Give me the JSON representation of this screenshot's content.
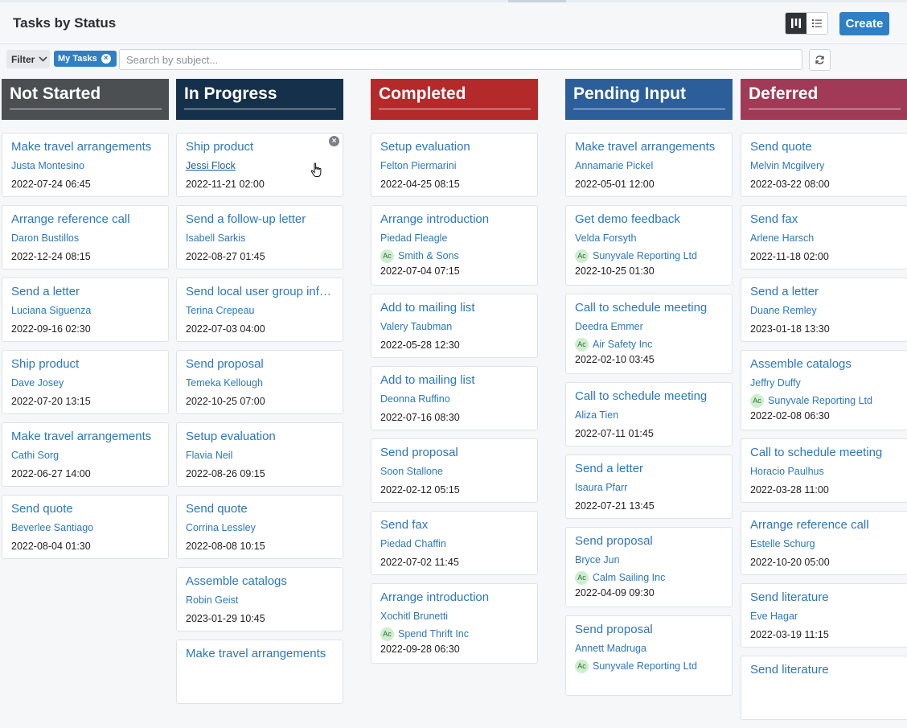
{
  "header": {
    "title": "Tasks by Status",
    "create_label": "Create"
  },
  "view_toggle": {
    "icons": [
      "board-view-icon",
      "list-view-icon"
    ],
    "active": "board"
  },
  "filter_bar": {
    "filter_label": "Filter",
    "active_chip": "My Tasks",
    "search": {
      "placeholder": "Search by subject...",
      "value": ""
    }
  },
  "columns": [
    {
      "title": "Not Started",
      "color": "#4c4f52",
      "cards": [
        {
          "title": "Make travel arrangements",
          "contact": "Justa Montesino",
          "date": "2022-07-24 06:45"
        },
        {
          "title": "Arrange reference call",
          "contact": "Daron Bustillos",
          "date": "2022-12-24 08:15"
        },
        {
          "title": "Send a letter",
          "contact": "Luciana Siguenza",
          "date": "2022-09-16 02:30"
        },
        {
          "title": "Ship product",
          "contact": "Dave Josey",
          "date": "2022-07-20 13:15"
        },
        {
          "title": "Make travel arrangements",
          "contact": "Cathi Sorg",
          "date": "2022-06-27 14:00"
        },
        {
          "title": "Send quote",
          "contact": "Beverlee Santiago",
          "date": "2022-08-04 01:30"
        }
      ]
    },
    {
      "title": "In Progress",
      "color": "#15304a",
      "cards": [
        {
          "title": "Ship product",
          "contact": "Jessi Flock",
          "date": "2022-11-21 02:00",
          "hover": true
        },
        {
          "title": "Send a follow-up letter",
          "contact": "Isabell Sarkis",
          "date": "2022-08-27 01:45"
        },
        {
          "title": "Send local user group infor...",
          "contact": "Terina Crepeau",
          "date": "2022-07-03 04:00"
        },
        {
          "title": "Send proposal",
          "contact": "Temeka Kellough",
          "date": "2022-10-25 07:00"
        },
        {
          "title": "Setup evaluation",
          "contact": "Flavia Neil",
          "date": "2022-08-26 09:15"
        },
        {
          "title": "Send quote",
          "contact": "Corrina Lessley",
          "date": "2022-08-08 10:15"
        },
        {
          "title": "Assemble catalogs",
          "contact": "Robin Geist",
          "date": "2023-01-29 10:45"
        },
        {
          "title": "Make travel arrangements",
          "contact": "",
          "date": ""
        }
      ]
    },
    {
      "title": "Completed",
      "color": "#b42a2a",
      "cards": [
        {
          "title": "Setup evaluation",
          "contact": "Felton Piermarini",
          "date": "2022-04-25 08:15"
        },
        {
          "title": "Arrange introduction",
          "contact": "Piedad Fleagle",
          "account": "Smith & Sons",
          "date": "2022-07-04 07:15"
        },
        {
          "title": "Add to mailing list",
          "contact": "Valery Taubman",
          "date": "2022-05-28 12:30"
        },
        {
          "title": "Add to mailing list",
          "contact": "Deonna Ruffino",
          "date": "2022-07-16 08:30"
        },
        {
          "title": "Send proposal",
          "contact": "Soon Stallone",
          "date": "2022-02-12 05:15"
        },
        {
          "title": "Send fax",
          "contact": "Piedad Chaffin",
          "date": "2022-07-02 11:45"
        },
        {
          "title": "Arrange introduction",
          "contact": "Xochitl Brunetti",
          "account": "Spend Thrift Inc",
          "date": "2022-09-28 06:30"
        }
      ]
    },
    {
      "title": "Pending Input",
      "color": "#2c5f99",
      "cards": [
        {
          "title": "Make travel arrangements",
          "contact": "Annamarie Pickel",
          "date": "2022-05-01 12:00"
        },
        {
          "title": "Get demo feedback",
          "contact": "Velda Forsyth",
          "account": "Sunyvale Reporting Ltd",
          "date": "2022-10-25 01:30"
        },
        {
          "title": "Call to schedule meeting",
          "contact": "Deedra Emmer",
          "account": "Air Safety Inc",
          "date": "2022-02-10 03:45"
        },
        {
          "title": "Call to schedule meeting",
          "contact": "Aliza Tien",
          "date": "2022-07-11 01:45"
        },
        {
          "title": "Send a letter",
          "contact": "Isaura Pfarr",
          "date": "2022-07-21 13:45"
        },
        {
          "title": "Send proposal",
          "contact": "Bryce Jun",
          "account": "Calm Sailing Inc",
          "date": "2022-04-09 09:30"
        },
        {
          "title": "Send proposal",
          "contact": "Annett Madruga",
          "account": "Sunyvale Reporting Ltd",
          "date": ""
        }
      ]
    },
    {
      "title": "Deferred",
      "color": "#a03a56",
      "cards": [
        {
          "title": "Send quote",
          "contact": "Melvin Mcgilvery",
          "date": "2022-03-22 08:00"
        },
        {
          "title": "Send fax",
          "contact": "Arlene Harsch",
          "date": "2022-11-18 02:00"
        },
        {
          "title": "Send a letter",
          "contact": "Duane Remley",
          "date": "2023-01-18 13:30"
        },
        {
          "title": "Assemble catalogs",
          "contact": "Jeffry Duffy",
          "account": "Sunyvale Reporting Ltd",
          "date": "2022-02-08 06:30"
        },
        {
          "title": "Call to schedule meeting",
          "contact": "Horacio Paulhus",
          "date": "2022-03-28 11:00"
        },
        {
          "title": "Arrange reference call",
          "contact": "Estelle Schurg",
          "date": "2022-10-20 05:00"
        },
        {
          "title": "Send literature",
          "contact": "Eve Hagar",
          "date": "2022-03-19 11:15"
        },
        {
          "title": "Send literature",
          "contact": "",
          "date": ""
        }
      ]
    }
  ],
  "account_avatar_text": "Ac"
}
